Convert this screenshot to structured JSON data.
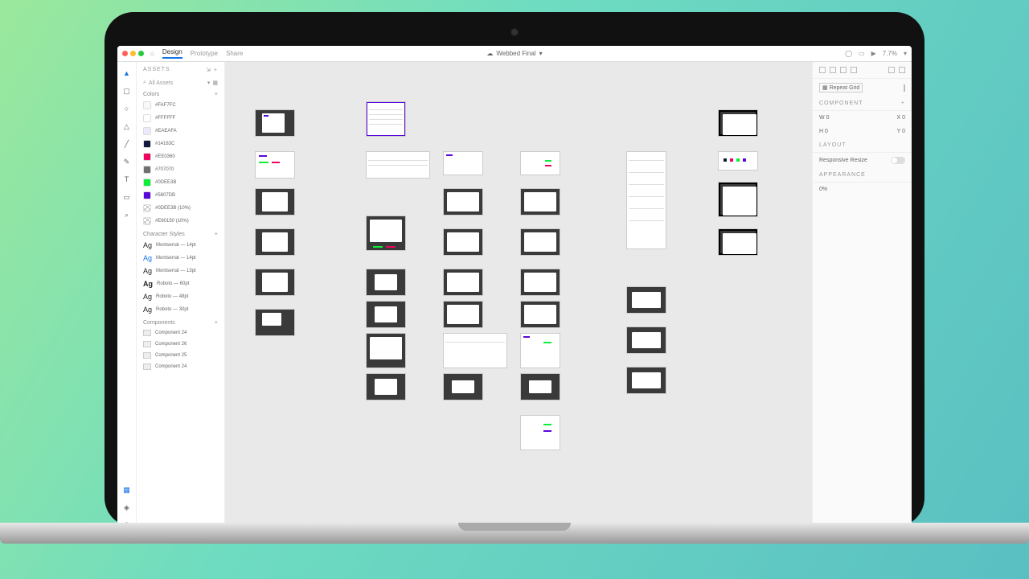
{
  "topbar": {
    "home": "⌂",
    "tabs": [
      "Design",
      "Prototype",
      "Share"
    ],
    "doc_title": "Webbed Final",
    "zoom": "7.7%"
  },
  "left": {
    "panel_title": "ASSETS",
    "search_label": "All Assets",
    "sections": {
      "colors": {
        "title": "Colors",
        "items": [
          {
            "hex": "#FAF7FC",
            "label": "#FAF7FC"
          },
          {
            "hex": "#FFFFFF",
            "label": "#FFFFFF"
          },
          {
            "hex": "#EAEAFA",
            "label": "#EAEAFA"
          },
          {
            "hex": "#14183C",
            "label": "#14183C"
          },
          {
            "hex": "#EE0360",
            "label": "#EE0360"
          },
          {
            "hex": "#707070",
            "label": "#707070"
          },
          {
            "hex": "#0DEE3B",
            "label": "#0DEE3B"
          },
          {
            "hex": "#5807DB",
            "label": "#5807DB"
          },
          {
            "hex": "#0DEE3B",
            "label": "#0DEE3B (10%)",
            "alpha": true
          },
          {
            "hex": "#E60150",
            "label": "#E60150 (10%)",
            "alpha": true
          }
        ]
      },
      "char_styles": {
        "title": "Character Styles",
        "items": [
          {
            "label": "Montserrat — 14pt",
            "style": "normal"
          },
          {
            "label": "Montserrat — 14pt",
            "style": "blue"
          },
          {
            "label": "Montserrat — 13pt",
            "style": "normal"
          },
          {
            "label": "Roboto — 60pt",
            "style": "bold"
          },
          {
            "label": "Roboto — 48pt",
            "style": "normal"
          },
          {
            "label": "Roboto — 30pt",
            "style": "normal"
          }
        ]
      },
      "components": {
        "title": "Components",
        "items": [
          {
            "label": "Component 24"
          },
          {
            "label": "Component 26"
          },
          {
            "label": "Component 25"
          },
          {
            "label": "Component 24"
          }
        ]
      }
    }
  },
  "right": {
    "repeat_grid": "Repeat Grid",
    "component": "COMPONENT",
    "w_label": "W",
    "h_label": "H",
    "x_label": "X",
    "y_label": "Y",
    "w": "0",
    "h": "0",
    "x": "0",
    "y": "0",
    "layout": "LAYOUT",
    "responsive": "Responsive Resize",
    "appearance": "APPEARANCE",
    "opacity": "0%"
  }
}
